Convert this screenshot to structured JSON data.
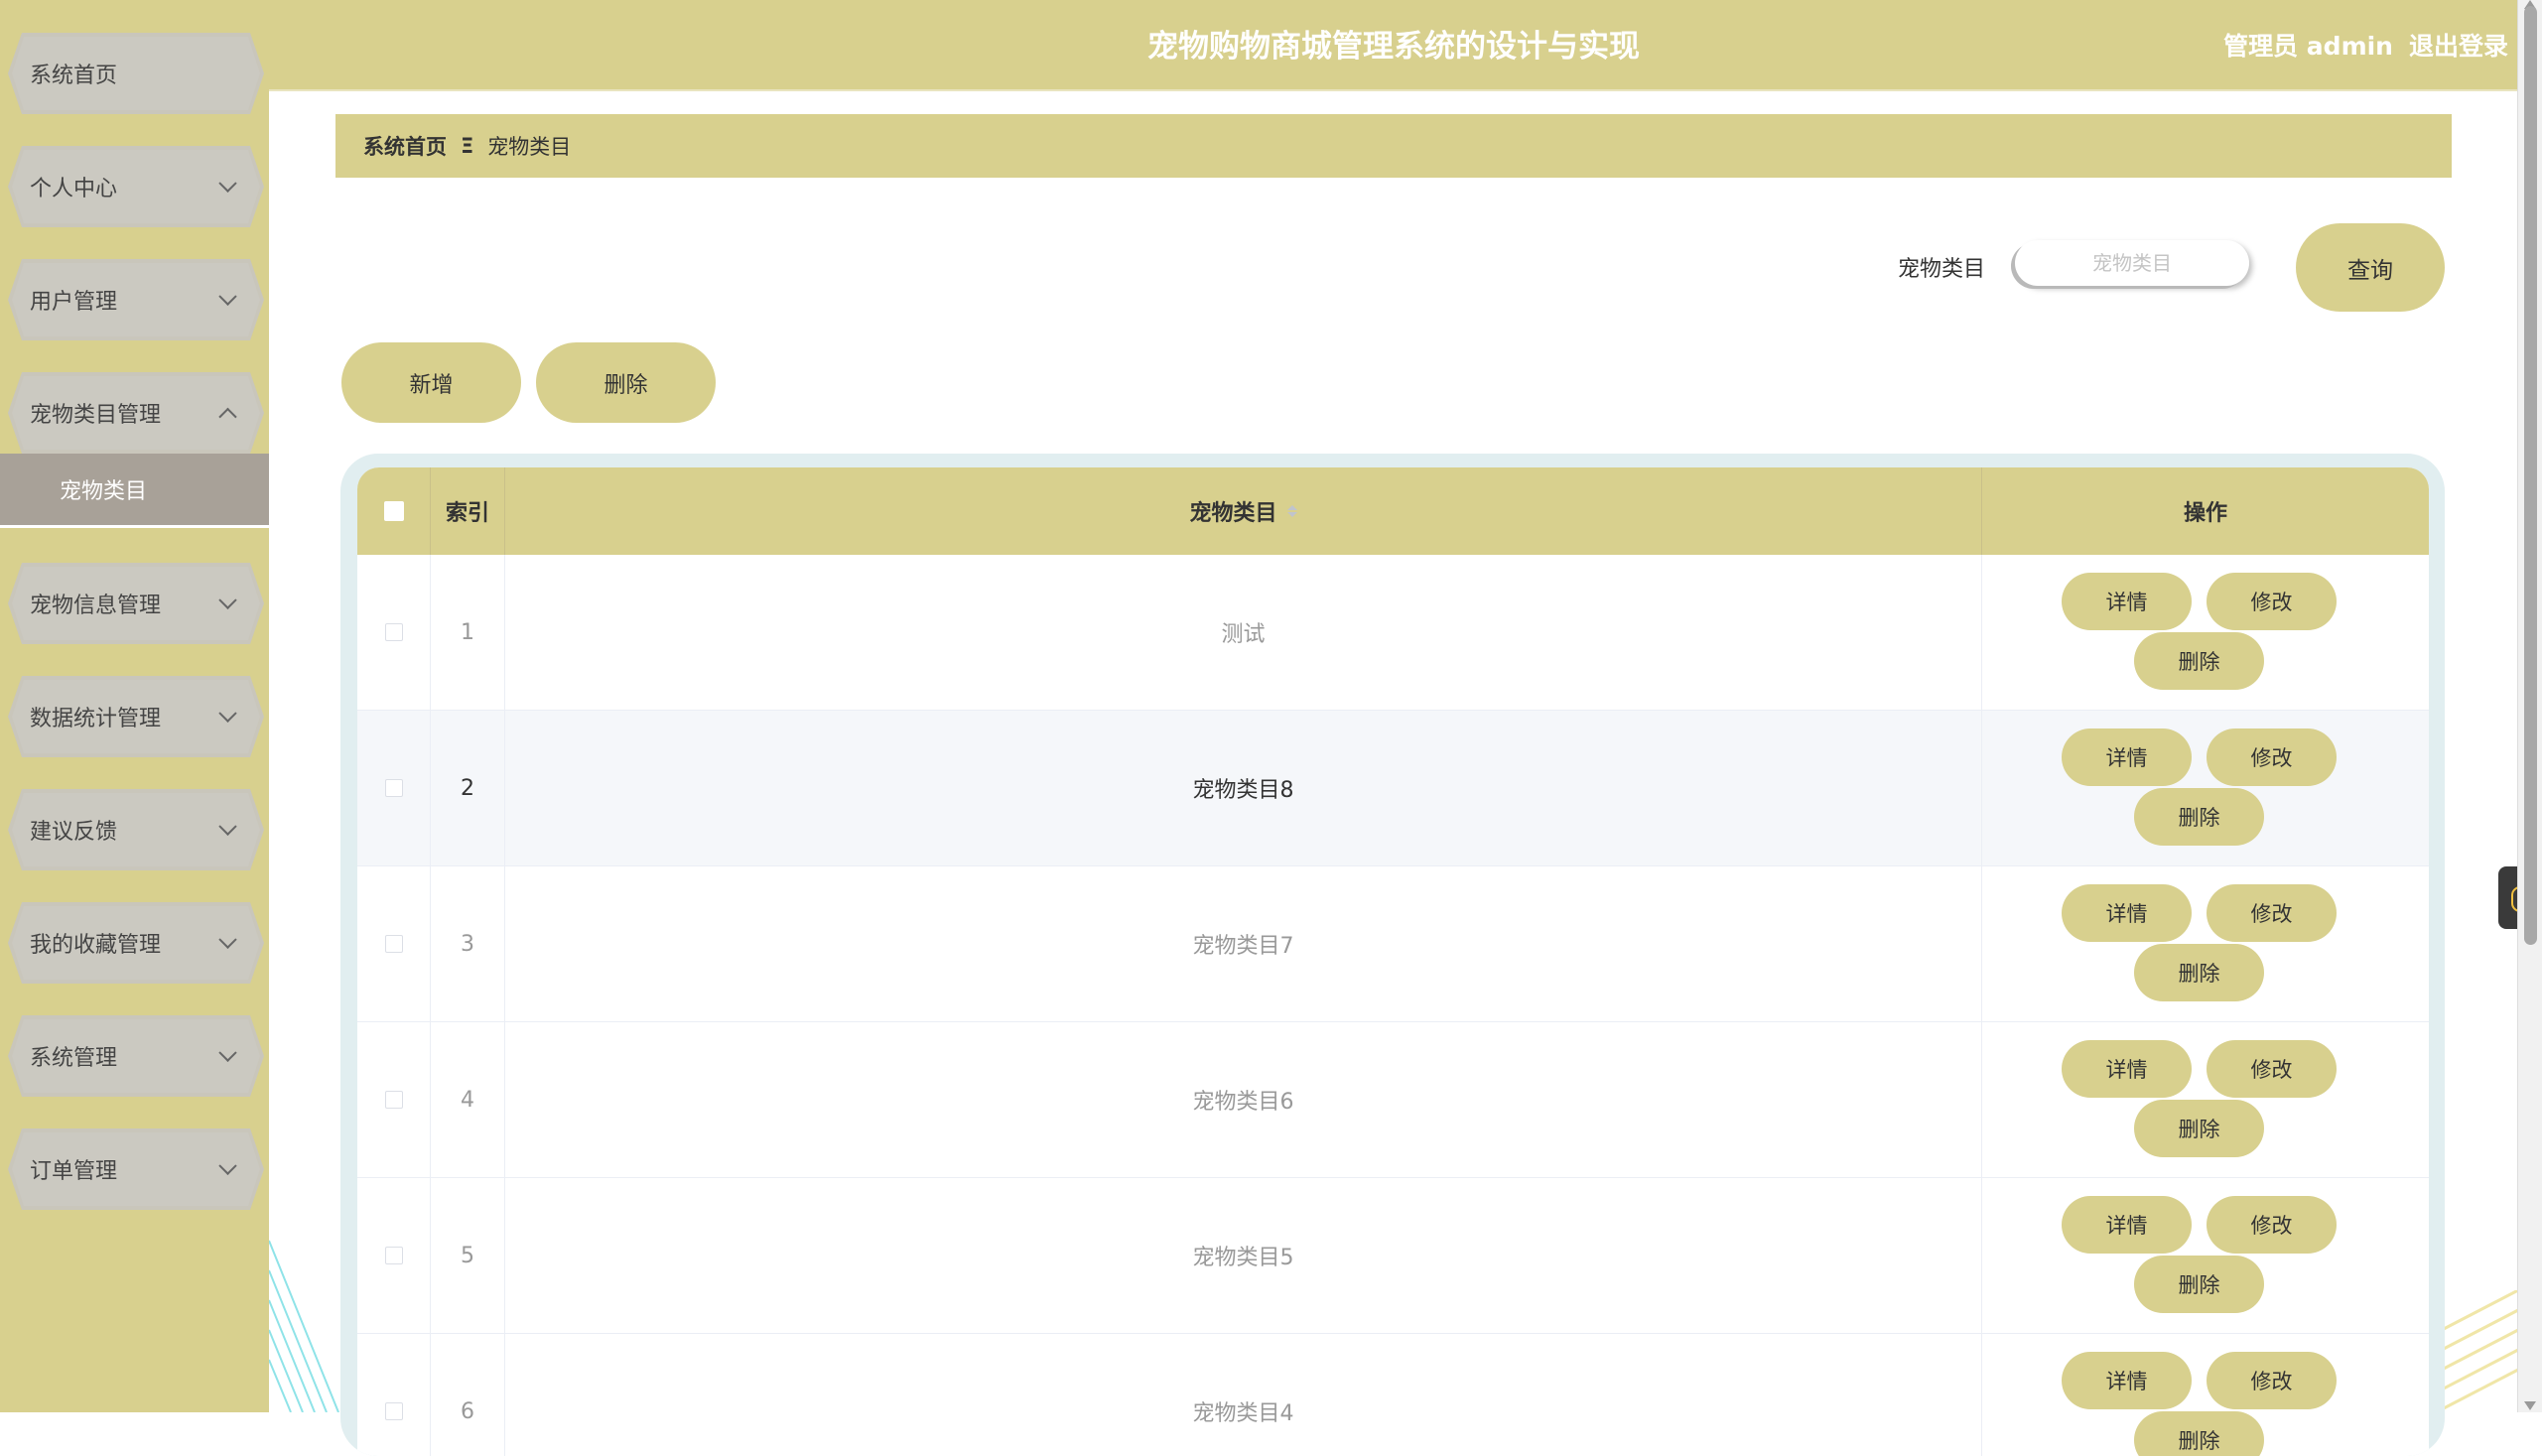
{
  "header": {
    "title": "宠物购物商城管理系统的设计与实现",
    "user": "管理员 admin",
    "logout": "退出登录"
  },
  "sidebar": {
    "items": [
      {
        "label": "系统首页",
        "has_arrow": false
      },
      {
        "label": "个人中心",
        "has_arrow": true
      },
      {
        "label": "用户管理",
        "has_arrow": true
      },
      {
        "label": "宠物类目管理",
        "has_arrow": true,
        "expanded": true
      },
      {
        "label": "宠物信息管理",
        "has_arrow": true
      },
      {
        "label": "数据统计管理",
        "has_arrow": true
      },
      {
        "label": "建议反馈",
        "has_arrow": true
      },
      {
        "label": "我的收藏管理",
        "has_arrow": true
      },
      {
        "label": "系统管理",
        "has_arrow": true
      },
      {
        "label": "订单管理",
        "has_arrow": true
      }
    ],
    "active_sub": "宠物类目"
  },
  "breadcrumb": {
    "home": "系统首页",
    "separator": "Ξ",
    "current": "宠物类目"
  },
  "search": {
    "label": "宠物类目",
    "placeholder": "宠物类目",
    "value": "",
    "button": "查询"
  },
  "actions": {
    "add": "新增",
    "delete": "删除"
  },
  "table": {
    "columns": {
      "index": "索引",
      "name": "宠物类目",
      "ops": "操作"
    },
    "rows": [
      {
        "index": "1",
        "name": "测试"
      },
      {
        "index": "2",
        "name": "宠物类目8"
      },
      {
        "index": "3",
        "name": "宠物类目7"
      },
      {
        "index": "4",
        "name": "宠物类目6"
      },
      {
        "index": "5",
        "name": "宠物类目5"
      },
      {
        "index": "6",
        "name": "宠物类目4"
      }
    ],
    "row_actions": {
      "detail": "详情",
      "edit": "修改",
      "delete": "删除"
    },
    "hovered_row": 2
  },
  "colors": {
    "accent": "#d8d08e",
    "sidebar_tab": "#cbc9c1",
    "active_sub": "#a8a198",
    "table_frame": "#e1eef0"
  }
}
